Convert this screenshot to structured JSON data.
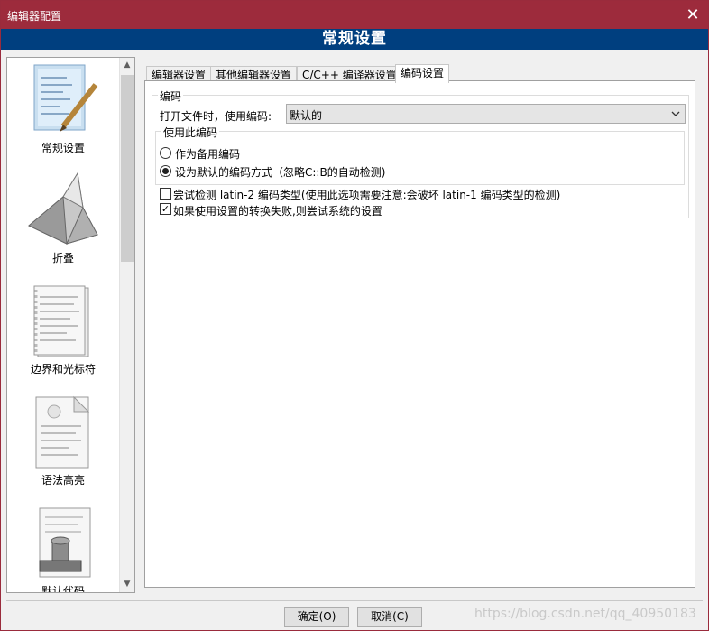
{
  "window": {
    "title": "编辑器配置",
    "close_glyph": "✕"
  },
  "header": {
    "title": "常规设置"
  },
  "sidebar": {
    "items": [
      {
        "label": "常规设置",
        "icon": "general-settings-icon"
      },
      {
        "label": "折叠",
        "icon": "folding-icon"
      },
      {
        "label": "边界和光标符",
        "icon": "margins-icon"
      },
      {
        "label": "语法高亮",
        "icon": "syntax-highlight-icon"
      },
      {
        "label": "默认代码",
        "icon": "default-code-icon"
      }
    ],
    "scroll_up": "▲",
    "scroll_down": "▼"
  },
  "tabs": [
    {
      "label": "编辑器设置",
      "active": false
    },
    {
      "label": "其他编辑器设置",
      "active": false
    },
    {
      "label": "C/C++ 编译器设置",
      "active": false
    },
    {
      "label": "编码设置",
      "active": true
    }
  ],
  "encoding": {
    "group_title": "编码",
    "open_file_label": "打开文件时，使用编码:",
    "open_file_value": "默认的",
    "use_group_title": "使用此编码",
    "radio_backup": "作为备用编码",
    "radio_default": "设为默认的编码方式（忽略C::B的自动检测)",
    "radio_selected": "default",
    "check_latin2": "尝试检测 latin-2 编码类型(使用此选项需要注意:会破坏 latin-1 编码类型的检测)",
    "check_latin2_checked": false,
    "check_fallback": "如果使用设置的转换失败,则尝试系统的设置",
    "check_fallback_checked": true
  },
  "buttons": {
    "ok": "确定(O)",
    "cancel": "取消(C)"
  },
  "watermark": "https://blog.csdn.net/qq_40950183",
  "colors": {
    "titlebar": "#9d2b3c",
    "header": "#003f7f"
  }
}
